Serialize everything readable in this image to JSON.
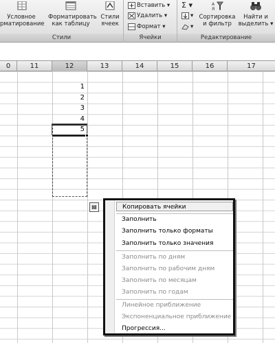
{
  "ribbon": {
    "styles_group": {
      "conditional_format_line1": "Условное",
      "conditional_format_line2": "рматирование",
      "format_table_line1": "Форматировать",
      "format_table_line2": "как таблицу",
      "cell_styles_line1": "Стили",
      "cell_styles_line2": "ячеек",
      "label": "Стили"
    },
    "cells_group": {
      "insert": "Вставить",
      "delete": "Удалить",
      "format": "Формат",
      "label": "Ячейки"
    },
    "editing_group": {
      "sigma": "Σ",
      "sort_filter_line1": "Сортировка",
      "sort_filter_line2": "и фильтр",
      "find_select_line1": "Найти и",
      "find_select_line2": "выделить",
      "label": "Редактирование"
    }
  },
  "sheet": {
    "columns": [
      "0",
      "11",
      "12",
      "13",
      "14",
      "15",
      "16",
      "17"
    ],
    "active_column": "12",
    "values": [
      "1",
      "2",
      "3",
      "4",
      "5"
    ]
  },
  "autofill_button": {
    "glyph": "▤"
  },
  "menu": {
    "items": [
      {
        "label": "Копировать ячейки",
        "enabled": true,
        "highlight": true
      },
      {
        "label": "Заполнить",
        "enabled": true
      },
      {
        "label": "Заполнить только форматы",
        "enabled": true
      },
      {
        "label": "Заполнить только значения",
        "enabled": true
      },
      {
        "label": "Заполнить по дням",
        "enabled": false
      },
      {
        "label": "Заполнить по рабочим дням",
        "enabled": false
      },
      {
        "label": "Заполнить по месяцам",
        "enabled": false
      },
      {
        "label": "Заполнить по годам",
        "enabled": false
      },
      {
        "label": "Линейное приближение",
        "enabled": false
      },
      {
        "label": "Экспоненциальное приближение",
        "enabled": false
      },
      {
        "label": "Прогрессия...",
        "enabled": true
      }
    ]
  }
}
